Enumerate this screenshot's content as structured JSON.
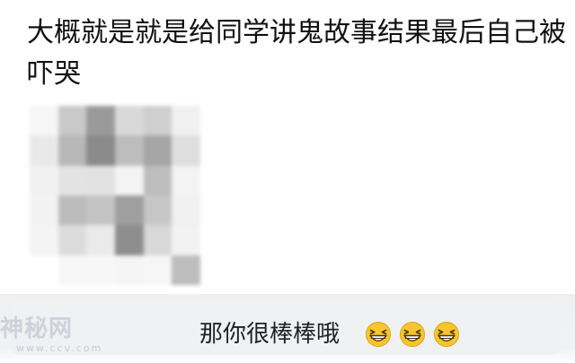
{
  "post": {
    "text": "大概就是就是给同学讲鬼故事结果最后自己被吓哭"
  },
  "mosaic": {
    "cells": [
      "#f6f6f6",
      "#c9c9c9",
      "#9a9a9a",
      "#d9d9d9",
      "#cfcfcf",
      "#f0f0f0",
      "#e9e9e9",
      "#b7b7b7",
      "#8a8a8a",
      "#bdbdbd",
      "#a6a6a6",
      "#dedede",
      "#f1f1f1",
      "#e3e3e3",
      "#e1e1e1",
      "#f3f3f3",
      "#bdbdbd",
      "#f3f3f3",
      "#f2f2f2",
      "#bcbcbc",
      "#c4c4c4",
      "#9f9f9f",
      "#c6c6c6",
      "#f0f0f0",
      "#f4f4f4",
      "#dcdcdc",
      "#eaeaea",
      "#8e8e8e",
      "#d8d8d8",
      "#f2f2f2",
      "#ffffff",
      "#f7f7f7",
      "#f7f7f7",
      "#f5f5f5",
      "#f6f6f6",
      "#bdbdbd"
    ]
  },
  "reply": {
    "text": "那你很棒棒哦",
    "emoji_icon": "grinning-squint-face-icon",
    "emoji_count": 3,
    "emoji_color": "#f7c52e"
  },
  "watermark": {
    "text": "神秘网",
    "sub": "www.ccv.com"
  }
}
